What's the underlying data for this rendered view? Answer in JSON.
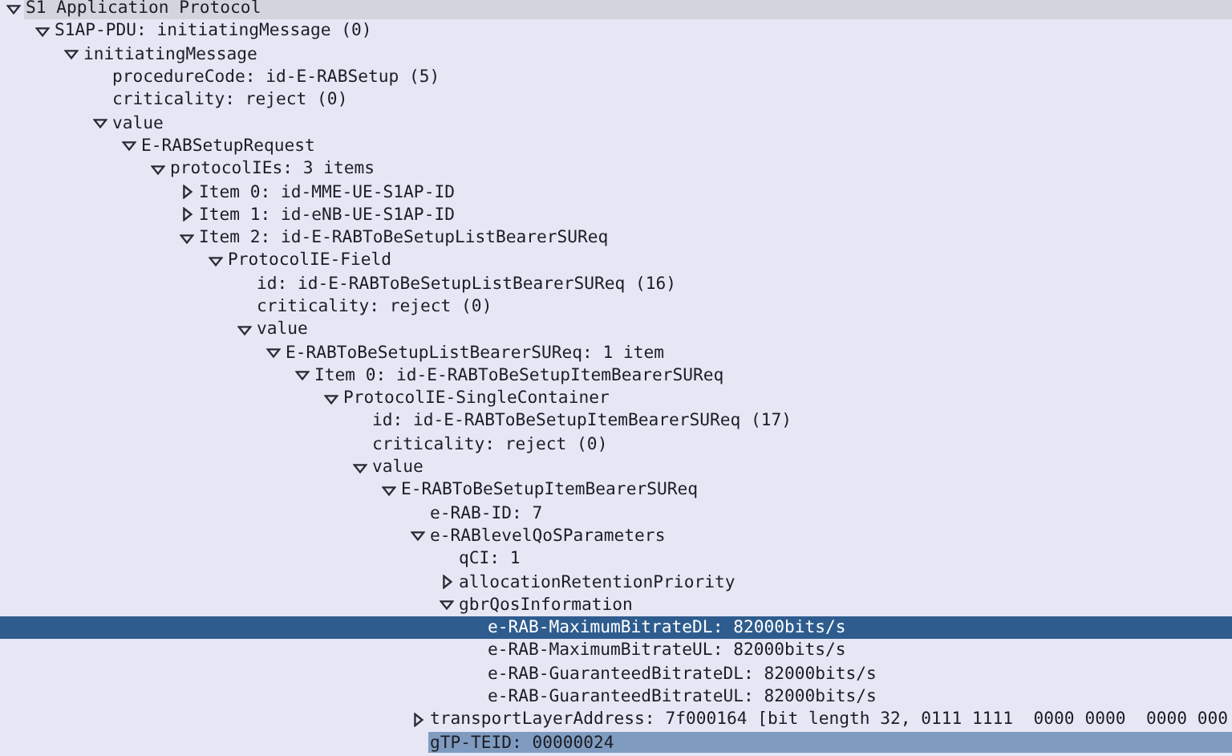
{
  "tree": [
    {
      "kind": "protocol",
      "label": "S1 Application Protocol",
      "expanded": true,
      "selected": false,
      "related": false,
      "children": [
        {
          "kind": "field",
          "label": "S1AP-PDU: initiatingMessage (0)",
          "expanded": true,
          "selected": false,
          "related": false,
          "children": [
            {
              "kind": "field",
              "label": "initiatingMessage",
              "expanded": true,
              "selected": false,
              "related": false,
              "children": [
                {
                  "kind": "field",
                  "label": "procedureCode: id-E-RABSetup (5)",
                  "selected": false,
                  "related": false
                },
                {
                  "kind": "field",
                  "label": "criticality: reject (0)",
                  "selected": false,
                  "related": false
                },
                {
                  "kind": "field",
                  "label": "value",
                  "expanded": true,
                  "selected": false,
                  "related": false,
                  "children": [
                    {
                      "kind": "field",
                      "label": "E-RABSetupRequest",
                      "expanded": true,
                      "selected": false,
                      "related": false,
                      "children": [
                        {
                          "kind": "field",
                          "label": "protocolIEs: 3 items",
                          "expanded": true,
                          "selected": false,
                          "related": false,
                          "children": [
                            {
                              "kind": "field",
                              "label": "Item 0: id-MME-UE-S1AP-ID",
                              "expanded": false,
                              "selected": false,
                              "related": false
                            },
                            {
                              "kind": "field",
                              "label": "Item 1: id-eNB-UE-S1AP-ID",
                              "expanded": false,
                              "selected": false,
                              "related": false
                            },
                            {
                              "kind": "field",
                              "label": "Item 2: id-E-RABToBeSetupListBearerSUReq",
                              "expanded": true,
                              "selected": false,
                              "related": false,
                              "children": [
                                {
                                  "kind": "field",
                                  "label": "ProtocolIE-Field",
                                  "expanded": true,
                                  "selected": false,
                                  "related": false,
                                  "children": [
                                    {
                                      "kind": "field",
                                      "label": "id: id-E-RABToBeSetupListBearerSUReq (16)",
                                      "selected": false,
                                      "related": false
                                    },
                                    {
                                      "kind": "field",
                                      "label": "criticality: reject (0)",
                                      "selected": false,
                                      "related": false
                                    },
                                    {
                                      "kind": "field",
                                      "label": "value",
                                      "expanded": true,
                                      "selected": false,
                                      "related": false,
                                      "children": [
                                        {
                                          "kind": "field",
                                          "label": "E-RABToBeSetupListBearerSUReq: 1 item",
                                          "expanded": true,
                                          "selected": false,
                                          "related": false,
                                          "children": [
                                            {
                                              "kind": "field",
                                              "label": "Item 0: id-E-RABToBeSetupItemBearerSUReq",
                                              "expanded": true,
                                              "selected": false,
                                              "related": false,
                                              "children": [
                                                {
                                                  "kind": "field",
                                                  "label": "ProtocolIE-SingleContainer",
                                                  "expanded": true,
                                                  "selected": false,
                                                  "related": false,
                                                  "children": [
                                                    {
                                                      "kind": "field",
                                                      "label": "id: id-E-RABToBeSetupItemBearerSUReq (17)",
                                                      "selected": false,
                                                      "related": false
                                                    },
                                                    {
                                                      "kind": "field",
                                                      "label": "criticality: reject (0)",
                                                      "selected": false,
                                                      "related": false
                                                    },
                                                    {
                                                      "kind": "field",
                                                      "label": "value",
                                                      "expanded": true,
                                                      "selected": false,
                                                      "related": false,
                                                      "children": [
                                                        {
                                                          "kind": "field",
                                                          "label": "E-RABToBeSetupItemBearerSUReq",
                                                          "expanded": true,
                                                          "selected": false,
                                                          "related": false,
                                                          "children": [
                                                            {
                                                              "kind": "field",
                                                              "label": "e-RAB-ID: 7",
                                                              "selected": false,
                                                              "related": false
                                                            },
                                                            {
                                                              "kind": "field",
                                                              "label": "e-RABlevelQoSParameters",
                                                              "expanded": true,
                                                              "selected": false,
                                                              "related": false,
                                                              "children": [
                                                                {
                                                                  "kind": "field",
                                                                  "label": "qCI: 1",
                                                                  "selected": false,
                                                                  "related": false
                                                                },
                                                                {
                                                                  "kind": "field",
                                                                  "label": "allocationRetentionPriority",
                                                                  "expanded": false,
                                                                  "selected": false,
                                                                  "related": false
                                                                },
                                                                {
                                                                  "kind": "field",
                                                                  "label": "gbrQosInformation",
                                                                  "expanded": true,
                                                                  "selected": false,
                                                                  "related": false,
                                                                  "children": [
                                                                    {
                                                                      "kind": "field",
                                                                      "label": "e-RAB-MaximumBitrateDL: 82000bits/s",
                                                                      "selected": true,
                                                                      "related": false
                                                                    },
                                                                    {
                                                                      "kind": "field",
                                                                      "label": "e-RAB-MaximumBitrateUL: 82000bits/s",
                                                                      "selected": false,
                                                                      "related": false
                                                                    },
                                                                    {
                                                                      "kind": "field",
                                                                      "label": "e-RAB-GuaranteedBitrateDL: 82000bits/s",
                                                                      "selected": false,
                                                                      "related": false
                                                                    },
                                                                    {
                                                                      "kind": "field",
                                                                      "label": "e-RAB-GuaranteedBitrateUL: 82000bits/s",
                                                                      "selected": false,
                                                                      "related": false
                                                                    }
                                                                  ]
                                                                }
                                                              ]
                                                            },
                                                            {
                                                              "kind": "field",
                                                              "label": "transportLayerAddress: 7f000164 [bit length 32, 0111 1111  0000 0000  0000 000",
                                                              "expanded": false,
                                                              "selected": false,
                                                              "related": false
                                                            },
                                                            {
                                                              "kind": "field",
                                                              "label": "gTP-TEID: 00000024",
                                                              "selected": false,
                                                              "related": true
                                                            }
                                                          ]
                                                        }
                                                      ]
                                                    }
                                                  ]
                                                }
                                              ]
                                            }
                                          ]
                                        }
                                      ]
                                    }
                                  ]
                                }
                              ]
                            }
                          ]
                        }
                      ]
                    }
                  ]
                }
              ]
            }
          ]
        }
      ]
    }
  ]
}
